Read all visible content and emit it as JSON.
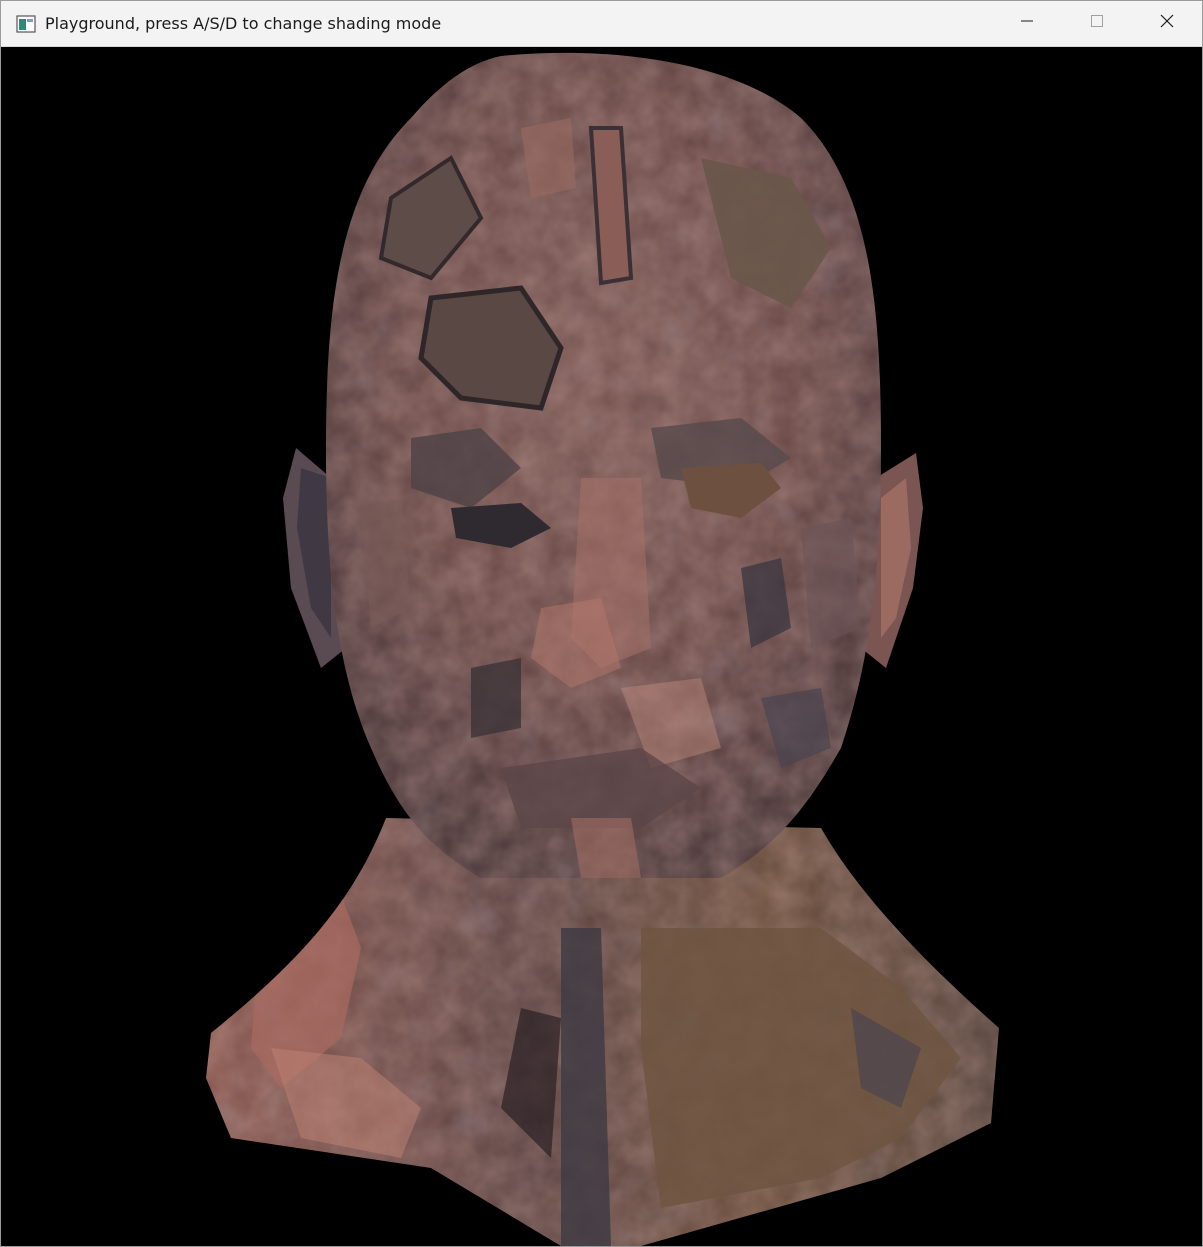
{
  "window": {
    "title": "Playground, press A/S/D to change shading mode",
    "controls": {
      "minimize_icon": "minimize-icon",
      "maximize_icon": "maximize-icon",
      "close_icon": "close-icon"
    }
  },
  "viewport": {
    "background": "#000000",
    "scene": "rendered-3d-head-model",
    "palette": {
      "skin_base": "#6e4e4b",
      "skin_highlight": "#b5776c",
      "skin_shadow": "#3f3438",
      "metal_blue": "#5a5a6e",
      "neck_brown": "#6d5140"
    }
  }
}
